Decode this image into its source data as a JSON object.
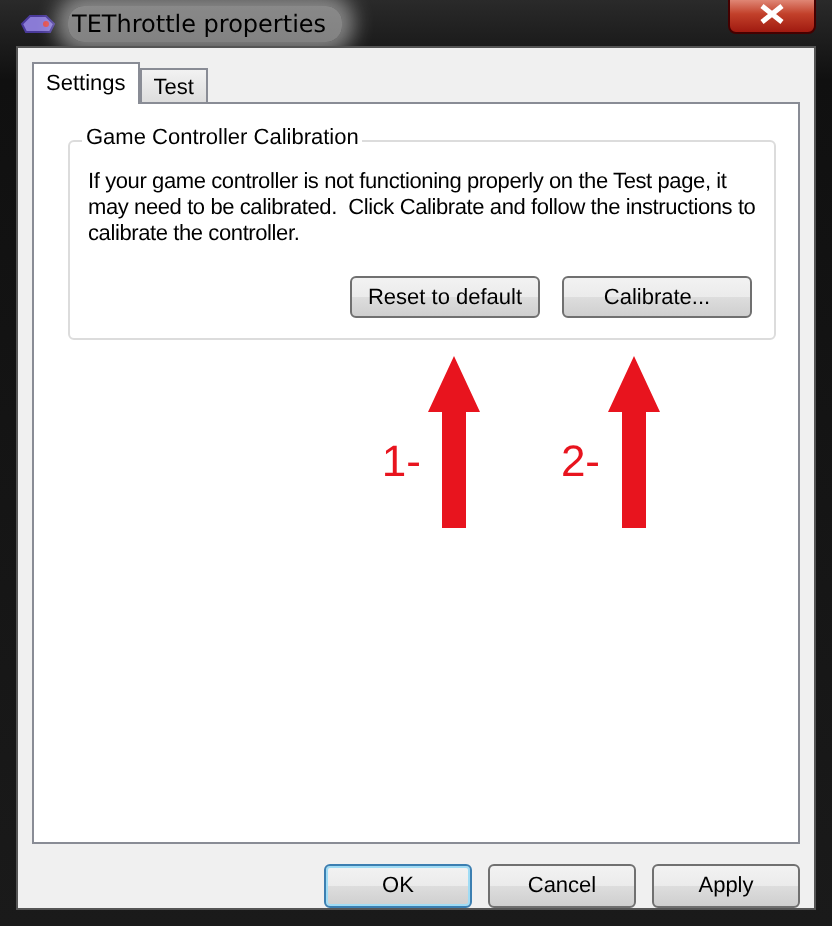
{
  "window": {
    "title": "TEThrottle properties"
  },
  "tabs": [
    {
      "label": "Settings",
      "selected": true
    },
    {
      "label": "Test",
      "selected": false
    }
  ],
  "group": {
    "title": "Game Controller Calibration",
    "text": "If your game controller is not functioning properly on the Test page, it may need to be calibrated.  Click Calibrate and follow the instructions to calibrate the controller.",
    "buttons": [
      "Reset to default",
      "Calibrate..."
    ]
  },
  "annotations": [
    {
      "label": "1-"
    },
    {
      "label": "2-"
    }
  ],
  "buttons": [
    {
      "label": "OK",
      "default": true
    },
    {
      "label": "Cancel",
      "default": false
    },
    {
      "label": "Apply",
      "default": false
    }
  ]
}
